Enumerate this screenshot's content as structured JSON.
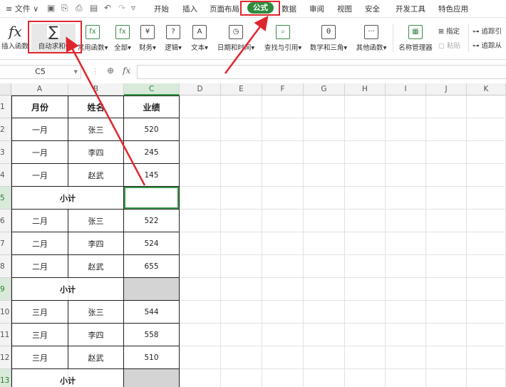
{
  "menubar": {
    "file_label": "文件",
    "tabs": [
      {
        "label": "开始",
        "active": false
      },
      {
        "label": "插入",
        "active": false
      },
      {
        "label": "页面布局",
        "active": false
      },
      {
        "label": "公式",
        "active": true
      },
      {
        "label": "数据",
        "active": false
      },
      {
        "label": "审阅",
        "active": false
      },
      {
        "label": "视图",
        "active": false
      },
      {
        "label": "安全",
        "active": false
      },
      {
        "label": "开发工具",
        "active": false
      },
      {
        "label": "特色应用",
        "active": false
      }
    ]
  },
  "ribbon": {
    "insert_function": "插入函数",
    "autosum": "自动求和",
    "common_functions": "常用函数",
    "all": "全部",
    "finance": "财务",
    "logic": "逻辑",
    "text": "文本",
    "datetime": "日期和时间",
    "lookup": "查找与引用",
    "math": "数学和三角",
    "other": "其他函数",
    "name_manager": "名称管理器",
    "specify": "指定",
    "paste": "粘贴",
    "trace_precedents": "追踪引",
    "trace_dependents": "追踪从"
  },
  "formula_bar": {
    "name_box": "C5",
    "fx": "fx",
    "value": ""
  },
  "columns": [
    "A",
    "B",
    "C",
    "D",
    "E",
    "F",
    "G",
    "H",
    "I",
    "J",
    "K"
  ],
  "rows": [
    "1",
    "2",
    "3",
    "4",
    "5",
    "6",
    "7",
    "8",
    "9",
    "10",
    "11",
    "12",
    "13"
  ],
  "table": {
    "headers": [
      "月份",
      "姓名",
      "业绩"
    ],
    "rows": [
      {
        "month": "一月",
        "name": "张三",
        "value": "520"
      },
      {
        "month": "一月",
        "name": "李四",
        "value": "245"
      },
      {
        "month": "一月",
        "name": "赵武",
        "value": "145"
      },
      {
        "subtotal": "小计"
      },
      {
        "month": "二月",
        "name": "张三",
        "value": "522"
      },
      {
        "month": "二月",
        "name": "李四",
        "value": "524"
      },
      {
        "month": "二月",
        "name": "赵武",
        "value": "655"
      },
      {
        "subtotal": "小计"
      },
      {
        "month": "三月",
        "name": "张三",
        "value": "544"
      },
      {
        "month": "三月",
        "name": "李四",
        "value": "558"
      },
      {
        "month": "三月",
        "name": "赵武",
        "value": "510"
      },
      {
        "subtotal": "小计"
      }
    ]
  },
  "colors": {
    "accent": "#2e8b3e",
    "annotation": "#e0262d",
    "subtotal_fill": "#d4d4d4"
  }
}
